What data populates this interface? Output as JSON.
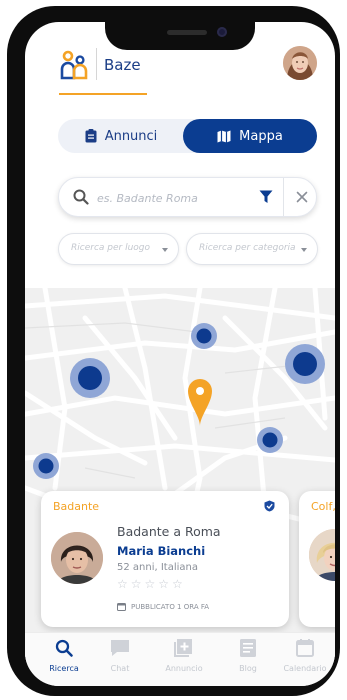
{
  "app": {
    "title": "Baze"
  },
  "toggle": {
    "list_label": "Annunci",
    "map_label": "Mappa",
    "active": "Mappa"
  },
  "search": {
    "placeholder": "es. Badante Roma"
  },
  "filters": {
    "location_placeholder": "Ricerca per luogo",
    "category_placeholder": "Ricerca per categoria"
  },
  "cards": [
    {
      "category": "Badante",
      "title": "Badante a Roma",
      "name": "Maria Bianchi",
      "details": "52 anni, Italiana",
      "rating": 0,
      "rating_max": 5,
      "published": "PUBBLICATO 1 ORA FA"
    },
    {
      "category": "Colf, b"
    }
  ],
  "tabs": [
    {
      "label": "Ricerca",
      "icon": "search-icon",
      "active": true
    },
    {
      "label": "Chat",
      "icon": "chat-icon",
      "active": false
    },
    {
      "label": "Annuncio",
      "icon": "add-icon",
      "active": false
    },
    {
      "label": "Blog",
      "icon": "blog-icon",
      "active": false
    },
    {
      "label": "Calendario",
      "icon": "calendar-icon",
      "active": false
    }
  ],
  "colors": {
    "brand_blue": "#0b3d91",
    "accent_orange": "#f4a326",
    "map_marker": "#0d3a8e",
    "map_marker_halo": "#8fa6d6"
  }
}
